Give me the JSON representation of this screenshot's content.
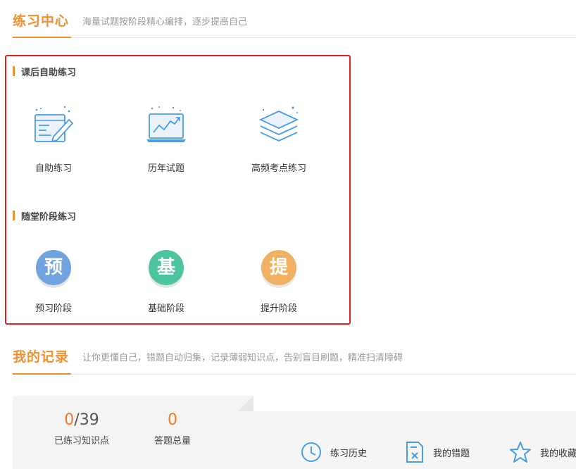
{
  "practice": {
    "title": "练习中心",
    "subtitle": "海量试题按阶段精心编排，逐步提高自己",
    "group1": {
      "title": "课后自助练习",
      "tiles": [
        {
          "label": "自助练习",
          "icon": "edit-form-icon"
        },
        {
          "label": "历年试题",
          "icon": "chart-monitor-icon"
        },
        {
          "label": "高频考点练习",
          "icon": "layers-icon"
        }
      ]
    },
    "group2": {
      "title": "随堂阶段练习",
      "stages": [
        {
          "char": "预",
          "label": "预习阶段",
          "color": "#6fa3e0"
        },
        {
          "char": "基",
          "label": "基础阶段",
          "color": "#4cc4a0"
        },
        {
          "char": "提",
          "label": "提升阶段",
          "color": "#f0b062"
        }
      ]
    }
  },
  "records": {
    "title": "我的记录",
    "subtitle": "让你更懂自己，错题自动归集，记录薄弱知识点，告别盲目刷题，精准扫清障碍",
    "stats": [
      {
        "value": "0",
        "total": "/39",
        "label": "已练习知识点"
      },
      {
        "value": "0",
        "total": "",
        "label": "答题总量"
      }
    ],
    "links": [
      {
        "label": "练习历史",
        "icon": "clock-icon"
      },
      {
        "label": "我的错题",
        "icon": "wrong-doc-icon"
      },
      {
        "label": "我的收藏",
        "icon": "star-icon"
      }
    ]
  },
  "colors": {
    "accent": "#f0902f",
    "highlight": "#e02424",
    "icon_blue": "#4a9de0"
  }
}
